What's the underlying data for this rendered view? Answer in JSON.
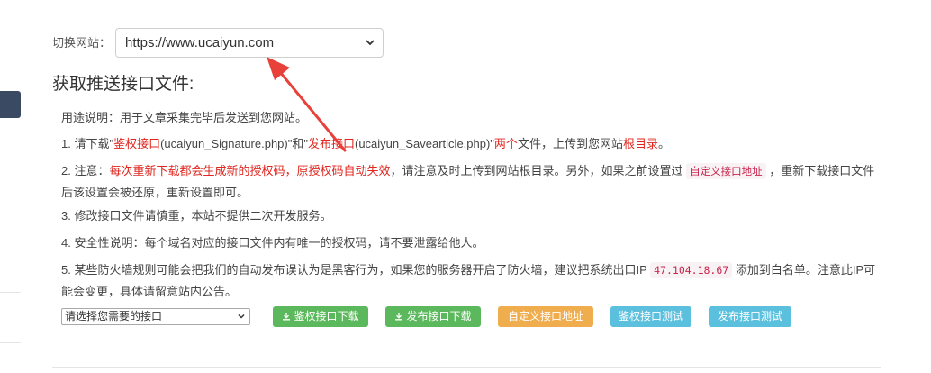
{
  "site": {
    "label": "切换网站：",
    "selected": "https://www.ucaiyun.com"
  },
  "heading": "获取推送接口文件:",
  "usage": "用途说明：用于文章采集完毕后发送到您网站。",
  "step1": {
    "a": "1. 请下载\"",
    "b": "鉴权接口",
    "c": "(ucaiyun_Signature.php)\"和\"",
    "d": "发布接口",
    "e": "(ucaiyun_Savearticle.php)\"",
    "f": "两个",
    "g": "文件，上传到您网站",
    "h": "根目录",
    "i": "。"
  },
  "step2": {
    "a": "2. 注意：",
    "b": "每次重新下载都会生成新的授权码，原授权码自动失效",
    "c": "，请注意及时上传到网站根目录。另外，如果之前设置过 ",
    "d": "自定义接口地址",
    "e": " ，重新下载接口文件后该设置会被还原，重新设置即可。"
  },
  "step3": "3. 修改接口文件请慎重，本站不提供二次开发服务。",
  "step4": "4. 安全性说明：每个域名对应的接口文件内有唯一的授权码，请不要泄露给他人。",
  "step5": {
    "a": "5. 某些防火墙规则可能会把我们的自动发布误认为是黑客行为，如果您的服务器开启了防火墙，建议把系统出口IP ",
    "ip": "47.104.18.67",
    "b": " 添加到白名单。注意此IP可能会变更，具体请留意站内公告。"
  },
  "interface_select": {
    "selected": "请选择您需要的接口"
  },
  "buttons": {
    "auth_download": "鉴权接口下载",
    "publish_download": "发布接口下载",
    "custom_url": "自定义接口地址",
    "auth_test": "鉴权接口测试",
    "publish_test": "发布接口测试"
  },
  "colors": {
    "accent_red": "#e0261f",
    "green": "#5cb85c",
    "orange": "#f0ad4e",
    "blue": "#5bc0de",
    "annotation_arrow": "#e8413a"
  },
  "icons": [
    "chevron-down-icon",
    "download-icon",
    "annotation-arrow"
  ]
}
